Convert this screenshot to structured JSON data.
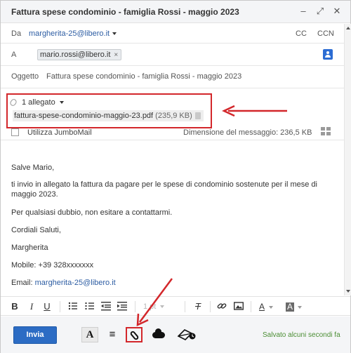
{
  "window": {
    "title": "Fattura spese condominio - famiglia Rossi - maggio 2023",
    "minimize": "–",
    "expand": "⤢",
    "close": "✕"
  },
  "from": {
    "label": "Da",
    "address": "margherita-25@libero.it",
    "cc": "CC",
    "ccn": "CCN"
  },
  "to": {
    "label": "A",
    "recipient": "mario.rossi@libero.it",
    "remove": "×"
  },
  "subject": {
    "label": "Oggetto",
    "value": "Fattura spese condominio - famiglia Rossi - maggio 2023"
  },
  "attachments": {
    "header": "1 allegato",
    "file_name": "fattura-spese-condominio-maggio-23.pdf",
    "file_size": "(235,9 KB)"
  },
  "jumbo": {
    "label": "Utilizza JumboMail",
    "message_size": "Dimensione del messaggio: 236,5 KB"
  },
  "message": {
    "greeting": "Salve Mario,",
    "line1": "ti invio in allegato la fattura da pagare per le spese di condominio sostenute per il mese di maggio 2023.",
    "line2": "Per qualsiasi dubbio, non esitare a contattarmi.",
    "closing": "Cordiali Saluti,",
    "name": "Margherita",
    "mobile": "Mobile: +39 328xxxxxxx",
    "email_label": "Email: ",
    "email_link": "margherita-25@libero.it"
  },
  "format_bar": {
    "bold": "B",
    "italic": "I",
    "underline": "U",
    "font_size": "1 pt",
    "clear_format": "T",
    "text_color": "A",
    "highlight": "A"
  },
  "bottom": {
    "send": "Invia",
    "font_button": "A",
    "align_button": "≡",
    "saved_status": "Salvato alcuni secondi fa"
  },
  "colors": {
    "accent_blue": "#2c6cc4",
    "link_blue": "#2d5da3",
    "highlight_red": "#d3272b",
    "saved_green": "#4b8e34"
  }
}
